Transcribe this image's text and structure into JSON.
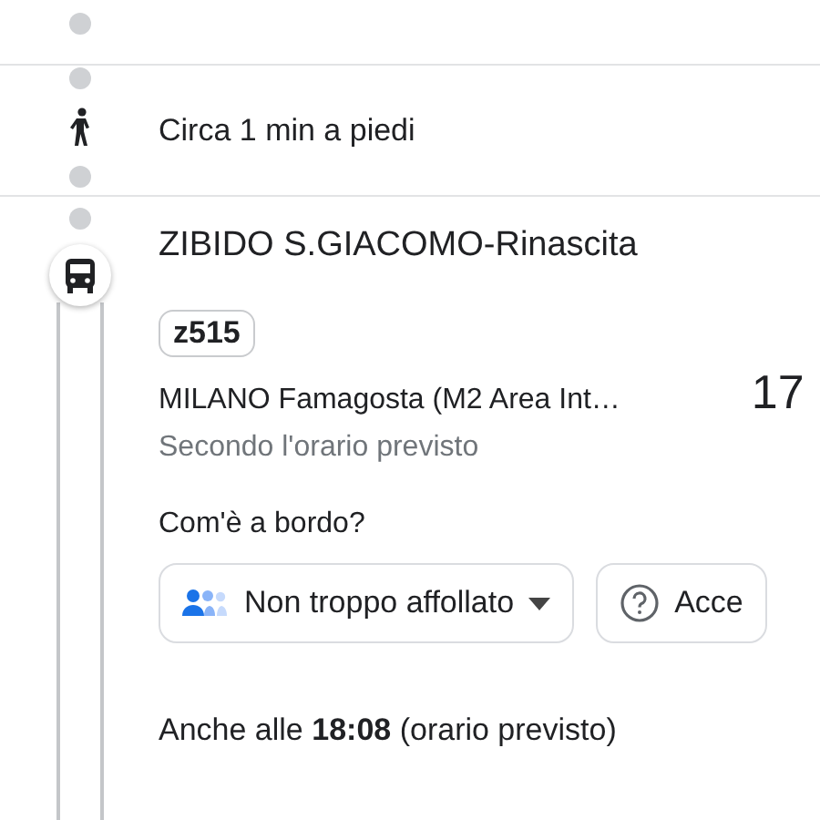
{
  "walk_step": {
    "text": "Circa 1 min a piedi"
  },
  "transit_step": {
    "stop_name": "ZIBIDO S.GIACOMO-Rinascita",
    "line_badge": "z515",
    "direction": "MILANO Famagosta (M2 Area Int…",
    "departure_time": "17",
    "schedule_note": "Secondo l'orario previsto",
    "onboard_label": "Com'è a bordo?",
    "chips": [
      {
        "kind": "crowding",
        "label": "Non troppo affollato"
      },
      {
        "kind": "help",
        "label": "Acce"
      }
    ],
    "also_at": "Anche alle **18:08** (orario previsto)"
  }
}
